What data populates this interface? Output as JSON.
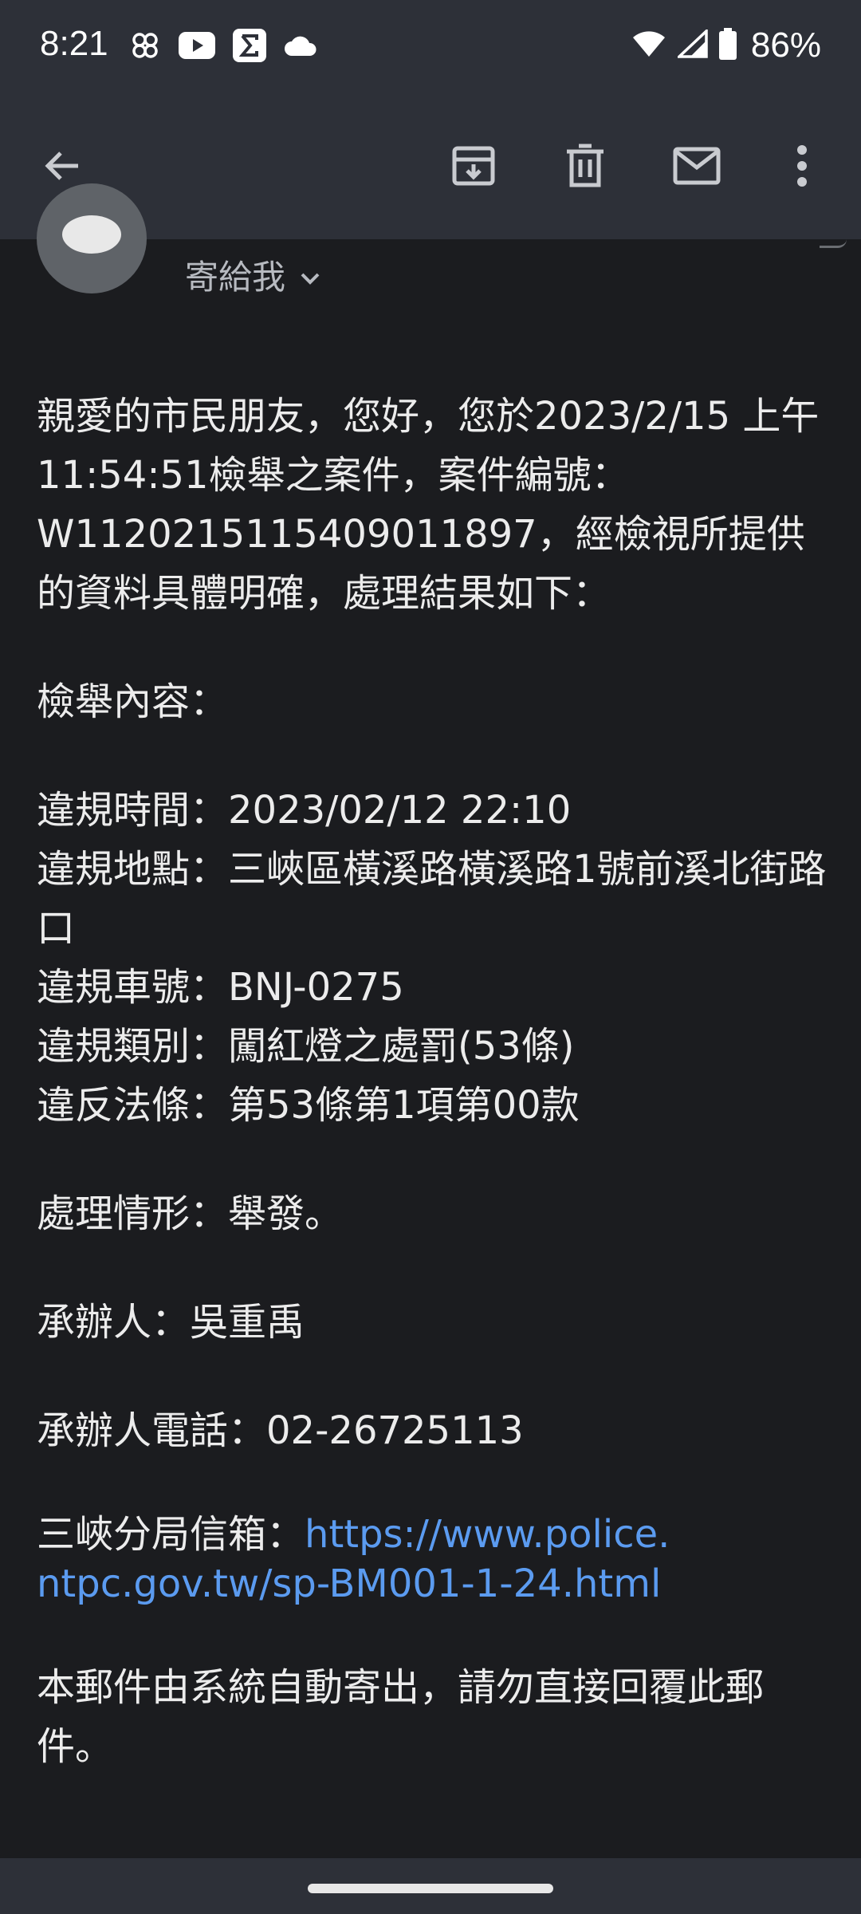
{
  "status_bar": {
    "time": "8:21",
    "left_icons": [
      "pinwheel-icon",
      "youtube-icon",
      "sigma-app-icon",
      "cloud-icon"
    ],
    "right_icons": [
      "wifi-icon",
      "cellular-signal-icon",
      "battery-icon"
    ],
    "battery": "86%"
  },
  "toolbar": {
    "icons": [
      "back-arrow-icon",
      "archive-icon",
      "delete-icon",
      "mark-unread-icon",
      "more-vert-icon"
    ]
  },
  "sender": {
    "recipient_label": "寄給我"
  },
  "email_body": {
    "intro": "親愛的市民朋友，您好，您於2023/2/15 上午 11:54:51檢舉之案件，案件編號：W1120215115409011897，經檢視所提供的資料具體明確，處理結果如下：",
    "report_heading": "檢舉內容：",
    "violation_time": "違規時間：2023/02/12 22:10",
    "violation_place": "違規地點：三峽區橫溪路橫溪路1號前溪北街路口",
    "violation_plate": "違規車號：BNJ-0275",
    "violation_type": "違規類別：闖紅燈之處罰(53條)",
    "violation_law": "違反法條：第53條第1項第00款",
    "handling": "處理情形：舉發。",
    "officer": "承辦人：吳重禹",
    "officer_phone": "承辦人電話：02-26725113",
    "mailbox_label": "三峽分局信箱：",
    "mailbox_url_line1": "https://www.police.",
    "mailbox_url_line2": "ntpc.gov.tw/sp-BM001-1-24.html",
    "footer": "本郵件由系統自動寄出，請勿直接回覆此郵件。"
  },
  "colors": {
    "background": "#1b1c1f",
    "bar": "#2d3038",
    "link": "#5b9bf0",
    "text": "#ececec"
  }
}
